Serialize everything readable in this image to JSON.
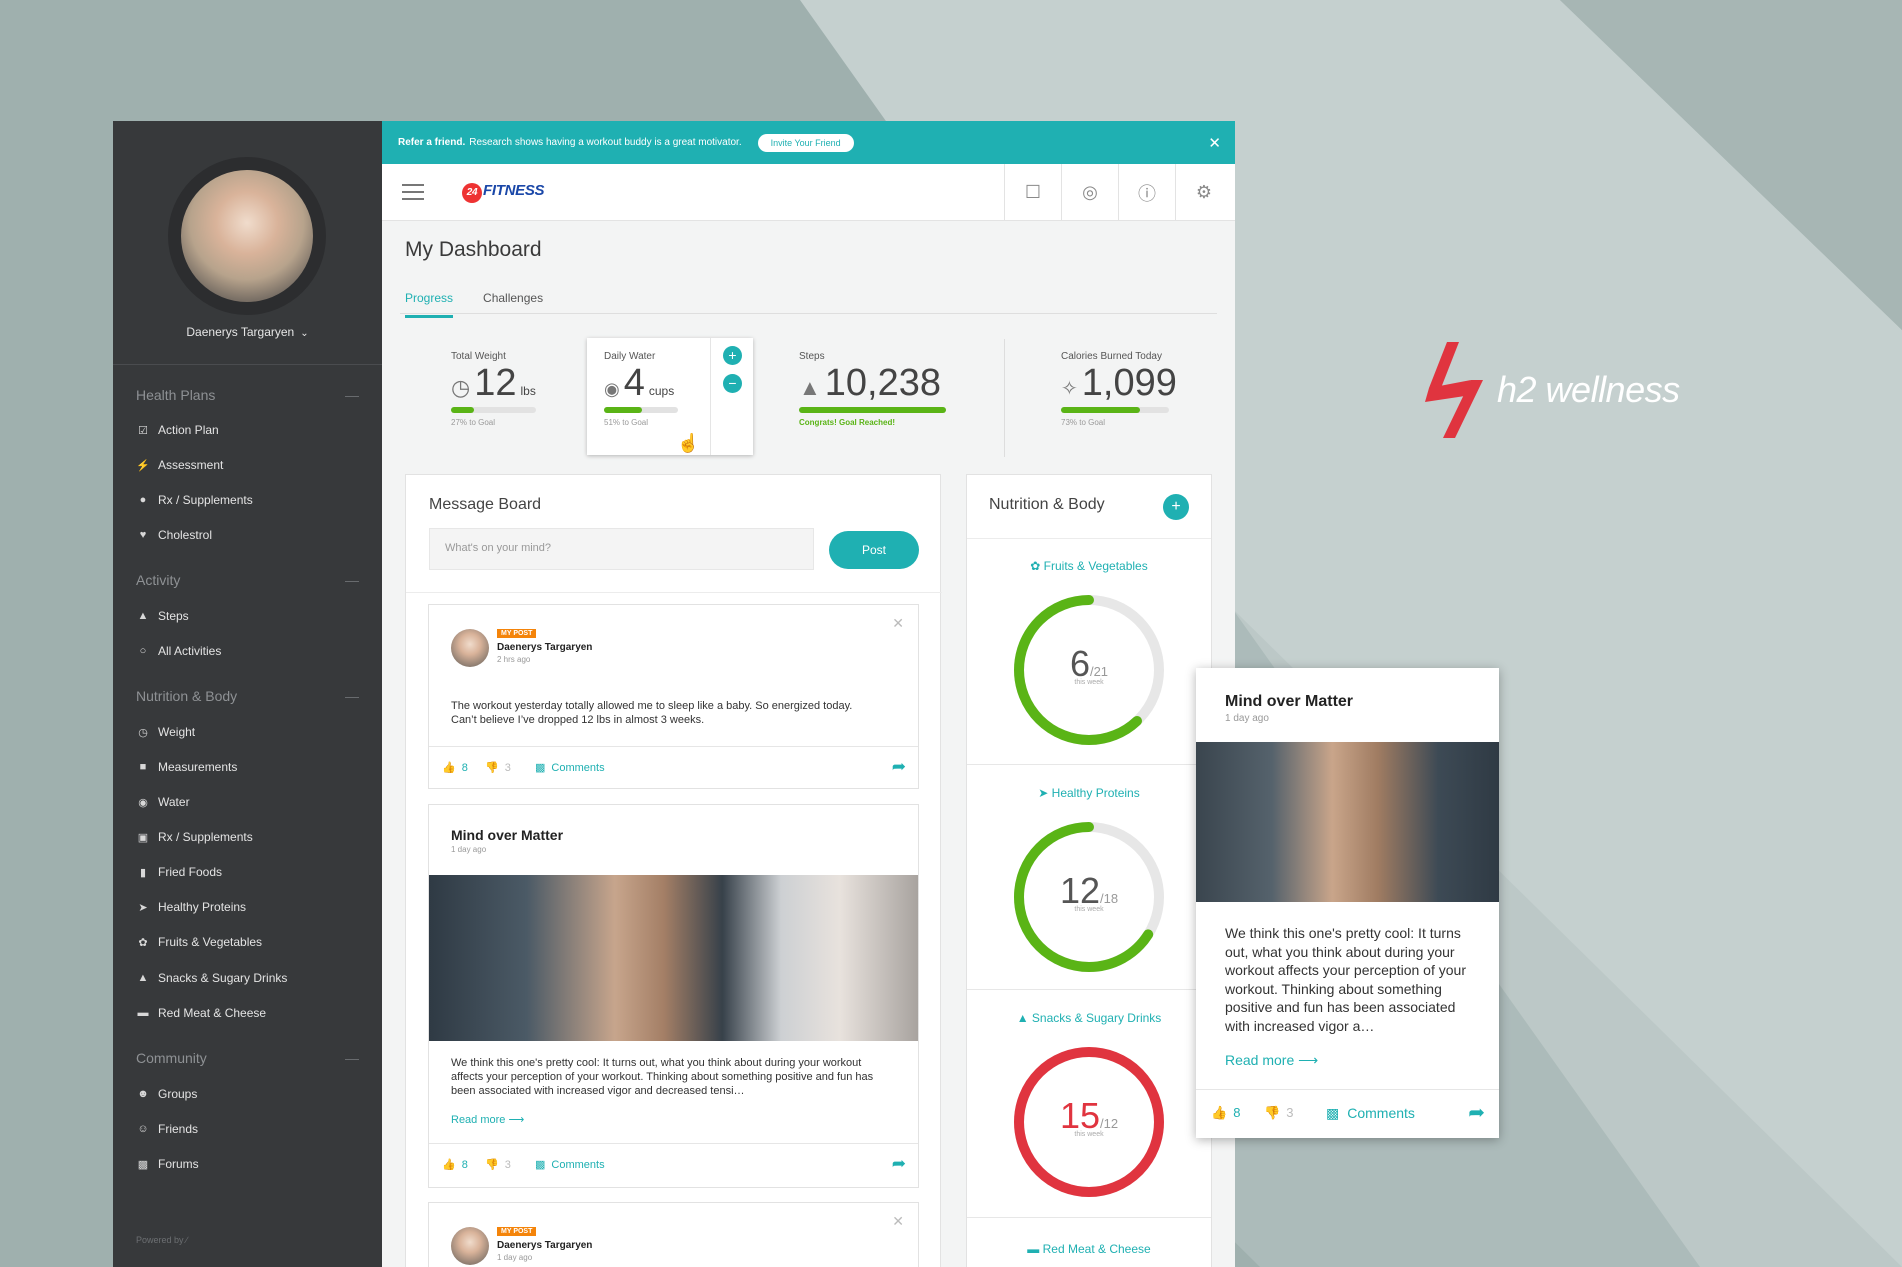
{
  "brand": {
    "name": "h2 wellness"
  },
  "sidebar": {
    "user_name": "Daenerys Targaryen",
    "sections": [
      {
        "title": "Health Plans",
        "items": [
          "Action Plan",
          "Assessment",
          "Rx / Supplements",
          "Cholestrol"
        ]
      },
      {
        "title": "Activity",
        "items": [
          "Steps",
          "All Activities"
        ]
      },
      {
        "title": "Nutrition & Body",
        "items": [
          "Weight",
          "Measurements",
          "Water",
          "Rx / Supplements",
          "Fried Foods",
          "Healthy Proteins",
          "Fruits & Vegetables",
          "Snacks & Sugary Drinks",
          "Red Meat & Cheese"
        ]
      },
      {
        "title": "Community",
        "items": [
          "Groups",
          "Friends",
          "Forums"
        ]
      }
    ],
    "powered": "Powered by"
  },
  "banner": {
    "bold": "Refer a friend.",
    "text": "Research shows having a workout buddy is a great motivator.",
    "button": "Invite Your Friend"
  },
  "topbar": {
    "logo": "FITNESS",
    "logo_badge": "24"
  },
  "page": {
    "title": "My Dashboard",
    "tabs": [
      "Progress",
      "Challenges"
    ]
  },
  "stats": {
    "weight": {
      "label": "Total Weight",
      "value": "12",
      "unit": "lbs",
      "progress": 0.27,
      "sub": "27% to Goal"
    },
    "water": {
      "label": "Daily Water",
      "value": "4",
      "unit": "cups",
      "progress": 0.51,
      "sub": "51% to Goal"
    },
    "steps": {
      "label": "Steps",
      "value": "10,238",
      "progress": 1.0,
      "sub": "Congrats! Goal Reached!"
    },
    "calories": {
      "label": "Calories Burned Today",
      "value": "1,099",
      "progress": 0.73,
      "sub": "73% to Goal"
    }
  },
  "message_board": {
    "title": "Message Board",
    "placeholder": "What's on your mind?",
    "post_button": "Post",
    "posts": [
      {
        "tag": "MY POST",
        "author": "Daenerys Targaryen",
        "time": "2 hrs ago",
        "text": "The workout yesterday totally allowed me to sleep like a baby. So energized today. Can’t believe I’ve dropped 12 lbs in almost 3 weeks.",
        "likes": "8",
        "dislikes": "3",
        "comments": "Comments"
      },
      {
        "title": "Mind over Matter",
        "time": "1 day ago",
        "text": "We think this one's pretty cool: It turns out, what you think about during your workout affects your perception of your workout. Thinking about something positive and fun has been associated with increased vigor and decreased tensi…",
        "read_more": "Read more",
        "likes": "8",
        "dislikes": "3",
        "comments": "Comments"
      },
      {
        "tag": "MY POST",
        "author": "Daenerys Targaryen",
        "time": "1 day ago"
      }
    ]
  },
  "nutrition": {
    "title": "Nutrition & Body",
    "rings": [
      {
        "label": "Fruits & Vegetables",
        "value": "6",
        "goal": "/21",
        "caption": "this week",
        "fraction": 0.62,
        "color": "#5ab416"
      },
      {
        "label": "Healthy Proteins",
        "value": "12",
        "goal": "/18",
        "caption": "this week",
        "fraction": 0.66,
        "color": "#5ab416"
      },
      {
        "label": "Snacks & Sugary Drinks",
        "value": "15",
        "goal": "/12",
        "caption": "this week",
        "fraction": 1.0,
        "color": "#e0343f"
      }
    ],
    "last_label": "Red Meat & Cheese"
  },
  "float_card": {
    "title": "Mind over Matter",
    "time": "1 day ago",
    "text": "We think this one's pretty cool: It turns out, what you think about during your workout affects your perception of your workout. Thinking about something positive and fun has been associated with increased vigor a…",
    "read_more": "Read more",
    "likes": "8",
    "dislikes": "3",
    "comments": "Comments"
  }
}
